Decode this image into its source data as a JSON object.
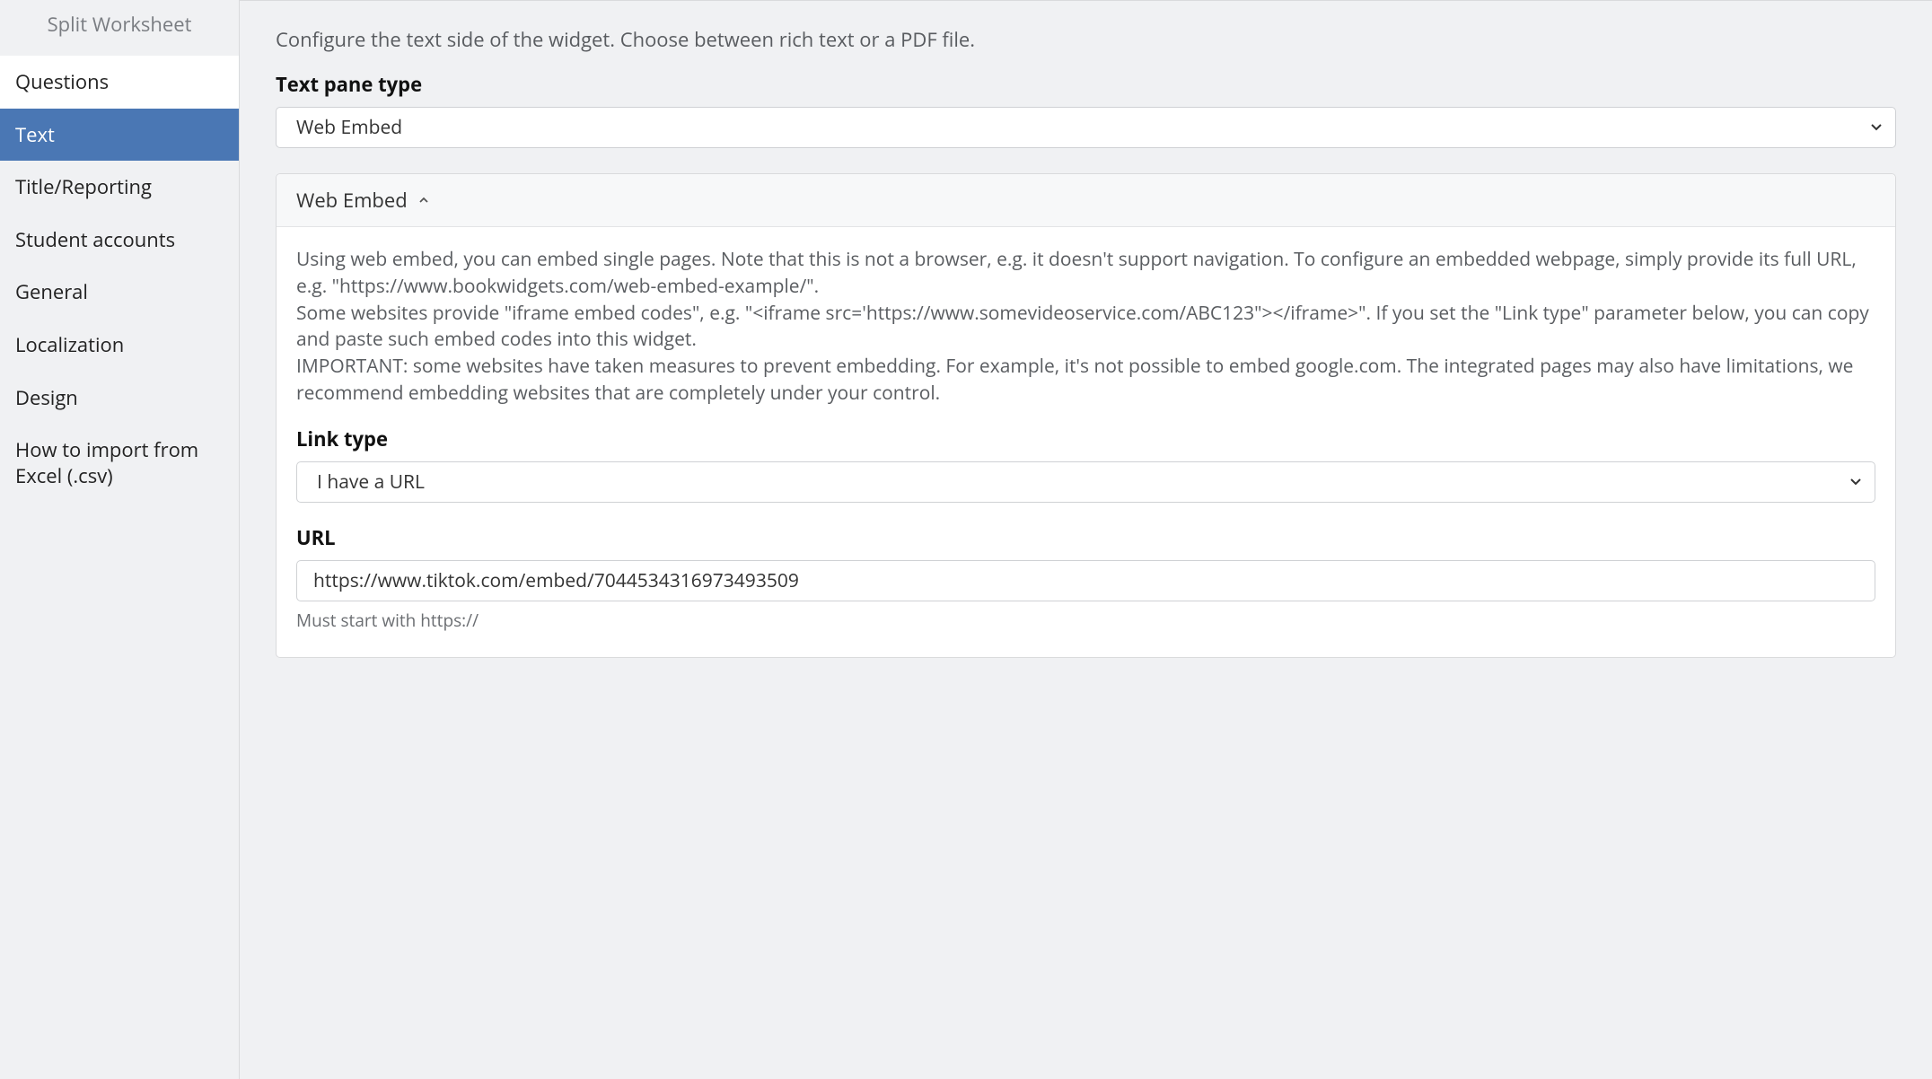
{
  "sidebar": {
    "title": "Split Worksheet",
    "items": [
      {
        "label": "Questions"
      },
      {
        "label": "Text"
      },
      {
        "label": "Title/Reporting"
      },
      {
        "label": "Student accounts"
      },
      {
        "label": "General"
      },
      {
        "label": "Localization"
      },
      {
        "label": "Design"
      },
      {
        "label": "How to import from Excel (.csv)"
      }
    ],
    "active_index": 1
  },
  "main": {
    "intro": "Configure the text side of the widget. Choose between rich text or a PDF file.",
    "text_pane_type_label": "Text pane type",
    "text_pane_type_value": "Web Embed",
    "panel": {
      "title": "Web Embed",
      "help": "Using web embed, you can embed single pages. Note that this is not a browser, e.g. it doesn't support navigation. To configure an embedded webpage, simply provide its full URL, e.g. \"https://www.bookwidgets.com/web-embed-example/\".\nSome websites provide \"iframe embed codes\", e.g. \"<iframe src='https://www.somevideoservice.com/ABC123\"></iframe>\". If you set the \"Link type\" parameter below, you can copy and paste such embed codes into this widget.\nIMPORTANT: some websites have taken measures to prevent embedding. For example, it's not possible to embed google.com. The integrated pages may also have limitations, we recommend embedding websites that are completely under your control.",
      "link_type_label": "Link type",
      "link_type_value": "I have a URL",
      "url_label": "URL",
      "url_value": "https://www.tiktok.com/embed/7044534316973493509",
      "url_hint": "Must start with https://"
    }
  }
}
